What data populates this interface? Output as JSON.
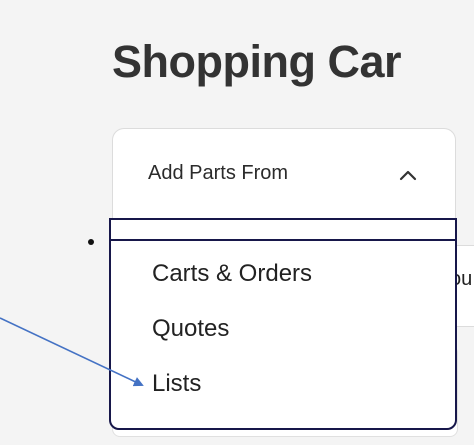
{
  "page": {
    "title": "Shopping Car"
  },
  "add_parts": {
    "label": "Add Parts From",
    "expanded": true
  },
  "dropdown": {
    "items": [
      {
        "label": "Carts & Orders"
      },
      {
        "label": "Quotes"
      },
      {
        "label": "Lists"
      }
    ]
  },
  "behind_text": "ou",
  "colors": {
    "dropdown_border": "#17174a",
    "arrow": "#4472c4",
    "title": "#333333",
    "background": "#f4f4f4"
  },
  "icons": {
    "toggle": "chevron-up-icon",
    "annotation": "arrow-icon"
  }
}
